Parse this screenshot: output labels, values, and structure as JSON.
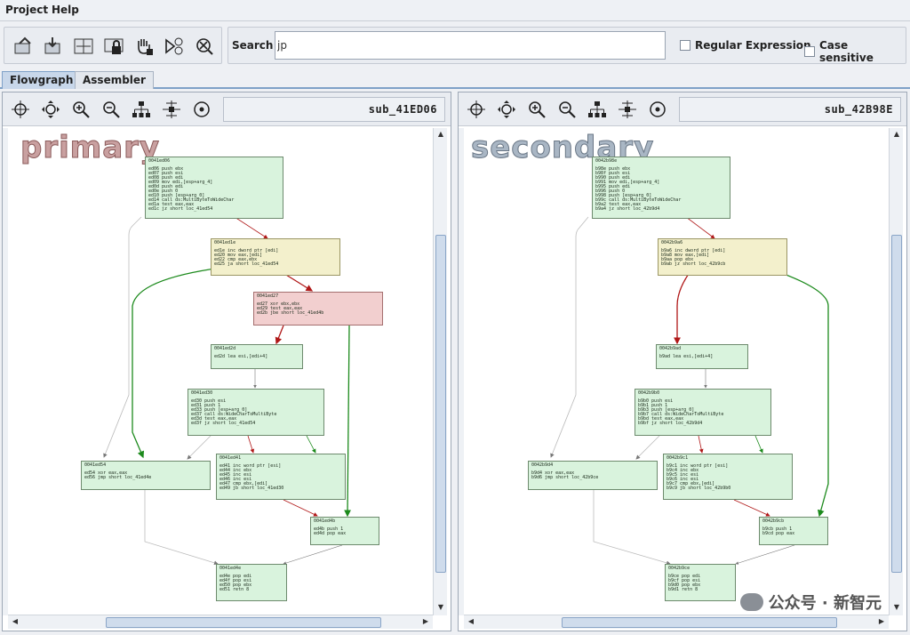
{
  "menu": {
    "project": "Project",
    "help": "Help"
  },
  "toolbar": {
    "icons": [
      "open-icon",
      "save-icon",
      "diff-icon",
      "lock-icon",
      "hand-icon",
      "zoom-icon",
      "close-icon"
    ]
  },
  "search": {
    "label": "Search",
    "value": "jp",
    "regex_label": "Regular Expression",
    "case_label": "Case sensitive"
  },
  "tabs": [
    "Flowgraph",
    "Assembler"
  ],
  "primary": {
    "function_name": "sub_41ED06",
    "watermark": "primary",
    "blocks": {
      "b1": {
        "addr": "0041ed06",
        "lines": [
          "ed06  push  ebx",
          "ed07  push  esi",
          "ed08  push  edi",
          "ed09  mov   edi,[esp+arg_4]",
          "ed0d  push  edi",
          "ed0e  push  0",
          "ed10  push  [esp+arg_0]",
          "ed14  call  ds:MultiByteToWideChar",
          "ed1a  test  eax,eax",
          "ed1c  jz    short loc_41ed54"
        ]
      },
      "b2": {
        "addr": "0041ed1e",
        "lines": [
          "ed1e  inc   dword ptr [edi]",
          "ed20  mov   eax,[edi]",
          "ed22  cmp   eax,ebx",
          "ed25  ja    short loc_41ed54"
        ]
      },
      "b3": {
        "addr": "0041ed27",
        "lines": [
          "ed27  xor   ebx,ebx",
          "ed29  test  eax,eax",
          "ed2b  jbe   short loc_41ed4b"
        ]
      },
      "b4": {
        "addr": "0041ed2d",
        "lines": [
          "ed2d  lea   esi,[edi+4]"
        ]
      },
      "b5": {
        "addr": "0041ed30",
        "lines": [
          "ed30  push  esi",
          "ed31  push  1",
          "ed33  push  [esp+arg_0]",
          "ed37  call  ds:WideCharToMultiByte",
          "ed3d  test  eax,eax",
          "ed3f  jz    short loc_41ed54"
        ]
      },
      "b6": {
        "addr": "0041ed54",
        "lines": [
          "ed54  xor   eax,eax",
          "ed56  jmp   short loc_41ed4e"
        ]
      },
      "b7": {
        "addr": "0041ed41",
        "lines": [
          "ed41  inc   word ptr [esi]",
          "ed44  inc   ebx",
          "ed45  inc   esi",
          "ed46  inc   esi",
          "ed47  cmp   ebx,[edi]",
          "ed49  jb    short loc_41ed30"
        ]
      },
      "b8": {
        "addr": "0041ed4b",
        "lines": [
          "ed4b  push  1",
          "ed4d  pop   eax"
        ]
      },
      "b9": {
        "addr": "0041ed4e",
        "lines": [
          "ed4e  pop   edi",
          "ed4f  pop   esi",
          "ed50  pop   ebx",
          "ed51  retn  8"
        ]
      }
    }
  },
  "secondary": {
    "function_name": "sub_42B98E",
    "watermark": "secondary",
    "blocks": {
      "b1": {
        "addr": "0042b98e",
        "lines": [
          "b98e  push  ebx",
          "b98f  push  esi",
          "b990  push  edi",
          "b991  mov   edi,[esp+arg_4]",
          "b995  push  edi",
          "b996  push  0",
          "b998  push  [esp+arg_0]",
          "b99c  call  ds:MultiByteToWideChar",
          "b9a2  test  eax,eax",
          "b9a4  jz    short loc_42b9d4"
        ]
      },
      "b2": {
        "addr": "0042b9a6",
        "lines": [
          "b9a6  inc   dword ptr [edi]",
          "b9a8  mov   eax,[edi]",
          "b9aa  pop   ebx",
          "b9ab  jz    short loc_42b9cb"
        ]
      },
      "b4": {
        "addr": "0042b9ad",
        "lines": [
          "b9ad  lea   esi,[edi+4]"
        ]
      },
      "b5": {
        "addr": "0042b9b0",
        "lines": [
          "b9b0  push  esi",
          "b9b1  push  1",
          "b9b3  push  [esp+arg_0]",
          "b9b7  call  ds:WideCharToMultiByte",
          "b9bd  test  eax,eax",
          "b9bf  jz    short loc_42b9d4"
        ]
      },
      "b6": {
        "addr": "0042b9d4",
        "lines": [
          "b9d4  xor   eax,eax",
          "b9d6  jmp   short loc_42b9ce"
        ]
      },
      "b7": {
        "addr": "0042b9c1",
        "lines": [
          "b9c1  inc   word ptr [esi]",
          "b9c4  inc   ebx",
          "b9c5  inc   esi",
          "b9c6  inc   esi",
          "b9c7  cmp   ebx,[edi]",
          "b9c9  jb    short loc_42b9b0"
        ]
      },
      "b8": {
        "addr": "0042b9cb",
        "lines": [
          "b9cb  push  1",
          "b9cd  pop   eax"
        ]
      },
      "b9": {
        "addr": "0042b9ce",
        "lines": [
          "b9ce  pop   edi",
          "b9cf  pop   esi",
          "b9d0  pop   ebx",
          "b9d1  retn  8"
        ]
      }
    }
  },
  "credit": "公众号 · 新智元",
  "colors": {
    "match": "#d9f3dd",
    "changed": "#f3f0cc",
    "unmatched": "#f2cfcf",
    "edge_true": "#1c8a1c",
    "edge_false": "#b01818"
  }
}
